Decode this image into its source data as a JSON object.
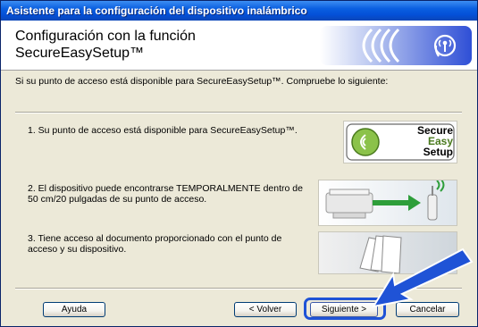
{
  "window": {
    "title": "Asistente para la configuración del dispositivo inalámbrico"
  },
  "header": {
    "title": "Configuración con la función SecureEasySetup™",
    "logo_icon": "wireless-signal-icon"
  },
  "main": {
    "intro": "Si su punto de acceso está disponible para SecureEasySetup™. Compruebe lo siguiente:",
    "items": [
      {
        "text": "1. Su punto de acceso está disponible para SecureEasySetup™."
      },
      {
        "text": "2. El dispositivo puede encontrarse TEMPORALMENTE dentro de 50 cm/20 pulgadas de su punto de acceso."
      },
      {
        "text": "3. Tiene acceso al documento proporcionado con el punto de acceso y su dispositivo."
      }
    ],
    "badge": {
      "line1": "Secure",
      "line2": "Easy",
      "line3": "Setup"
    }
  },
  "footer": {
    "help": "Ayuda",
    "back": "< Volver",
    "next": "Siguiente >",
    "cancel": "Cancelar"
  },
  "colors": {
    "title_bar": "#0450d8",
    "highlight": "#1f53d6",
    "badge_text": "#4a7a1e"
  }
}
